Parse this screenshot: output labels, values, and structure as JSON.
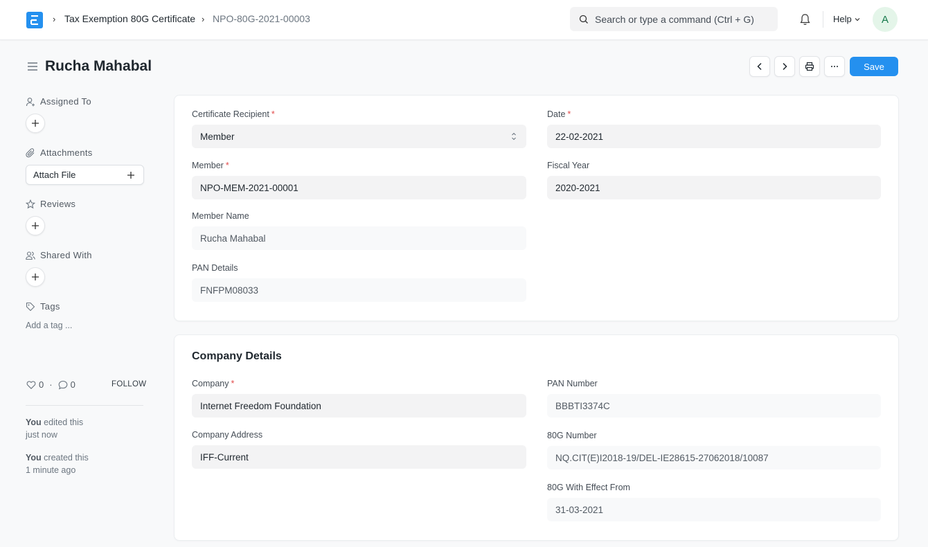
{
  "navbar": {
    "logo_letter": "E",
    "breadcrumbs": [
      "Tax Exemption 80G Certificate",
      "NPO-80G-2021-00003"
    ],
    "search_placeholder": "Search or type a command (Ctrl + G)",
    "help_label": "Help",
    "avatar_initial": "A"
  },
  "page": {
    "title": "Rucha Mahabal",
    "save_label": "Save"
  },
  "sidebar": {
    "assigned_to": "Assigned To",
    "attachments": "Attachments",
    "attach_file": "Attach File",
    "reviews": "Reviews",
    "shared_with": "Shared With",
    "tags": "Tags",
    "add_tag": "Add a tag ...",
    "likes_count": "0",
    "comments_count": "0",
    "follow": "FOLLOW",
    "activity": [
      {
        "actor": "You",
        "action": " edited this",
        "time": "just now"
      },
      {
        "actor": "You",
        "action": " created this",
        "time": "1 minute ago"
      }
    ]
  },
  "form": {
    "certificate_recipient": {
      "label": "Certificate Recipient",
      "value": "Member",
      "required": "*"
    },
    "date": {
      "label": "Date",
      "value": "22-02-2021",
      "required": "*"
    },
    "member": {
      "label": "Member",
      "value": "NPO-MEM-2021-00001",
      "required": "*"
    },
    "fiscal_year": {
      "label": "Fiscal Year",
      "value": "2020-2021"
    },
    "member_name": {
      "label": "Member Name",
      "value": "Rucha Mahabal"
    },
    "pan_details": {
      "label": "PAN Details",
      "value": "FNFPM08033"
    }
  },
  "company_section": {
    "title": "Company Details",
    "company": {
      "label": "Company",
      "value": "Internet Freedom Foundation",
      "required": "*"
    },
    "company_address": {
      "label": "Company Address",
      "value": "IFF-Current"
    },
    "pan_number": {
      "label": "PAN Number",
      "value": "BBBTI3374C"
    },
    "number_80g": {
      "label": "80G Number",
      "value": "NQ.CIT(E)I2018-19/DEL-IE28615-27062018/10087"
    },
    "effect_from": {
      "label": "80G With Effect From",
      "value": "31-03-2021"
    }
  }
}
